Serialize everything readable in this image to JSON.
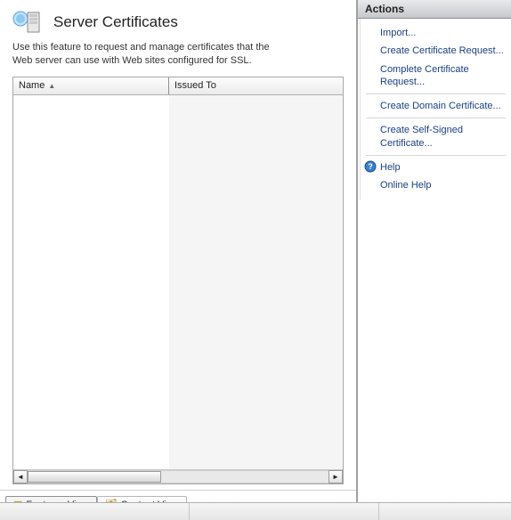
{
  "main": {
    "title": "Server Certificates",
    "description": "Use this feature to request and manage certificates that the Web server can use with Web sites configured for SSL.",
    "table": {
      "columns": {
        "name": "Name",
        "issuedTo": "Issued To"
      }
    },
    "tabs": {
      "features": "Features View",
      "content": "Content View"
    }
  },
  "actions": {
    "header": "Actions",
    "import": "Import...",
    "createRequest": "Create Certificate Request...",
    "completeRequest": "Complete Certificate Request...",
    "createDomain": "Create Domain Certificate...",
    "createSelfSigned": "Create Self-Signed Certificate...",
    "help": "Help",
    "onlineHelp": "Online Help"
  }
}
